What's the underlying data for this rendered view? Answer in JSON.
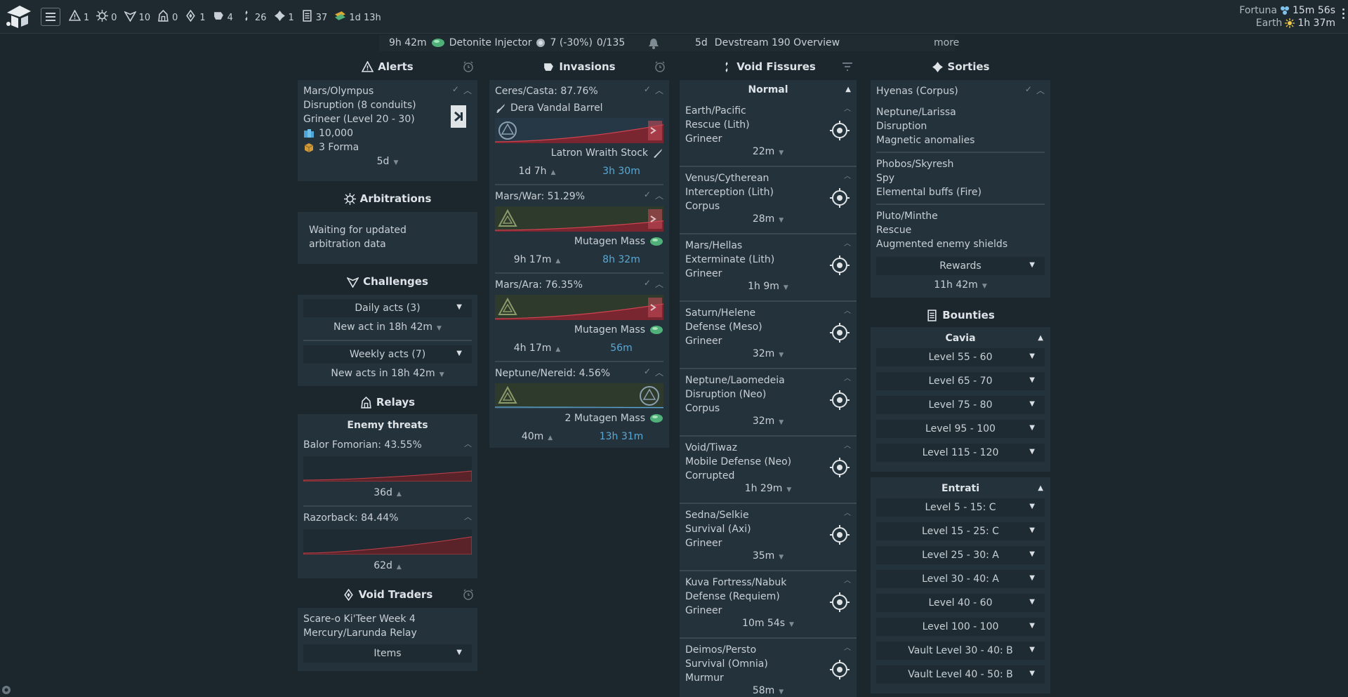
{
  "topbar": {
    "stats": [
      {
        "icon": "alert-icon",
        "value": "1"
      },
      {
        "icon": "arbitration-icon",
        "value": "0"
      },
      {
        "icon": "challenges-icon",
        "value": "10"
      },
      {
        "icon": "relays-icon",
        "value": "0"
      },
      {
        "icon": "void-trader-icon",
        "value": "1"
      },
      {
        "icon": "invasions-icon",
        "value": "4"
      },
      {
        "icon": "fissures-icon",
        "value": "26"
      },
      {
        "icon": "sorties-icon",
        "value": "1"
      },
      {
        "icon": "bounties-icon",
        "value": "37"
      },
      {
        "icon": "event-icon",
        "value": "1d 13h"
      }
    ],
    "cycles": [
      {
        "name": "Fortuna",
        "icon": "warm-cycle-icon",
        "time": "15m 56s"
      },
      {
        "name": "Earth",
        "icon": "day-cycle-icon",
        "time": "1h 37m"
      }
    ]
  },
  "news": {
    "deal_time": "9h 42m",
    "deal_item": "Detonite Injector",
    "deal_price": "7 (-30%)",
    "deal_stock": "0/135",
    "news_age": "5d",
    "news_title": "Devstream 190 Overview",
    "more": "more"
  },
  "alerts": {
    "title": "Alerts",
    "items": [
      {
        "node": "Mars/Olympus",
        "mission": "Disruption (8 conduits)",
        "enemy": "Grineer (Level 20 - 30)",
        "credits": "10,000",
        "reward": "3 Forma",
        "time": "5d"
      }
    ]
  },
  "arbitrations": {
    "title": "Arbitrations",
    "text1": "Waiting for updated",
    "text2": "arbitration data"
  },
  "challenges": {
    "title": "Challenges",
    "daily": "Daily acts (3)",
    "daily_next": "New act in 18h 42m",
    "weekly": "Weekly acts (7)",
    "weekly_next": "New acts in 18h 42m"
  },
  "relays": {
    "title": "Relays",
    "subtitle": "Enemy threats",
    "items": [
      {
        "name": "Balor Fomorian: 43.55%",
        "progress": 0.4355,
        "time": "36d"
      },
      {
        "name": "Razorback: 84.44%",
        "progress": 0.8444,
        "time": "62d"
      }
    ]
  },
  "void_traders": {
    "title": "Void Traders",
    "name": "Scare-o Ki'Teer Week 4",
    "location": "Mercury/Larunda Relay",
    "items_label": "Items"
  },
  "invasions": {
    "title": "Invasions",
    "items": [
      {
        "node": "Ceres/Casta: 87.76%",
        "progress": 0.8776,
        "attacker_reward": "Dera Vandal Barrel",
        "defender_reward": "Latron Wraith Stock",
        "eta": "1d 7h",
        "time": "3h 30m"
      },
      {
        "node": "Mars/War: 51.29%",
        "progress": 0.5129,
        "attacker_reward": "",
        "defender_reward": "Mutagen Mass",
        "eta": "9h 17m",
        "time": "8h 32m"
      },
      {
        "node": "Mars/Ara: 76.35%",
        "progress": 0.7635,
        "attacker_reward": "",
        "defender_reward": "Mutagen Mass",
        "eta": "4h 17m",
        "time": "56m"
      },
      {
        "node": "Neptune/Nereid: 4.56%",
        "progress": 0.0456,
        "attacker_reward": "",
        "defender_reward": "2 Mutagen Mass",
        "eta": "40m",
        "time": "13h 31m"
      }
    ]
  },
  "fissures": {
    "title": "Void Fissures",
    "group": "Normal",
    "items": [
      {
        "node": "Earth/Pacific",
        "mission": "Rescue (Lith)",
        "enemy": "Grineer",
        "time": "22m",
        "icon": "rescue-icon"
      },
      {
        "node": "Venus/Cytherean",
        "mission": "Interception (Lith)",
        "enemy": "Corpus",
        "time": "28m",
        "icon": "interception-icon"
      },
      {
        "node": "Mars/Hellas",
        "mission": "Exterminate (Lith)",
        "enemy": "Grineer",
        "time": "1h 9m",
        "icon": "exterminate-icon"
      },
      {
        "node": "Saturn/Helene",
        "mission": "Defense (Meso)",
        "enemy": "Grineer",
        "time": "32m",
        "icon": "defense-icon"
      },
      {
        "node": "Neptune/Laomedeia",
        "mission": "Disruption (Neo)",
        "enemy": "Corpus",
        "time": "32m",
        "icon": "disruption-icon"
      },
      {
        "node": "Void/Tiwaz",
        "mission": "Mobile Defense (Neo)",
        "enemy": "Corrupted",
        "time": "1h 29m",
        "icon": "mobile-defense-icon"
      },
      {
        "node": "Sedna/Selkie",
        "mission": "Survival (Axi)",
        "enemy": "Grineer",
        "time": "35m",
        "icon": "survival-icon"
      },
      {
        "node": "Kuva Fortress/Nabuk",
        "mission": "Defense (Requiem)",
        "enemy": "Grineer",
        "time": "10m 54s",
        "icon": "defense-icon"
      },
      {
        "node": "Deimos/Persto",
        "mission": "Survival (Omnia)",
        "enemy": "Murmur",
        "time": "58m",
        "icon": "omnia-icon"
      }
    ]
  },
  "sorties": {
    "title": "Sorties",
    "boss": "Hyenas (Corpus)",
    "missions": [
      {
        "node": "Neptune/Larissa",
        "type": "Disruption",
        "modifier": "Magnetic anomalies"
      },
      {
        "node": "Phobos/Skyresh",
        "type": "Spy",
        "modifier": "Elemental buffs (Fire)"
      },
      {
        "node": "Pluto/Minthe",
        "type": "Rescue",
        "modifier": "Augmented enemy shields"
      }
    ],
    "rewards": "Rewards",
    "time": "11h 42m"
  },
  "bounties": {
    "title": "Bounties",
    "groups": [
      {
        "name": "Cavia",
        "levels": [
          "Level 55 - 60",
          "Level 65 - 70",
          "Level 75 - 80",
          "Level 95 - 100",
          "Level 115 - 120"
        ]
      },
      {
        "name": "Entrati",
        "levels": [
          "Level 5 - 15: C",
          "Level 15 - 25: C",
          "Level 25 - 30: A",
          "Level 30 - 40: A",
          "Level 40 - 60",
          "Level 100 - 100",
          "Vault Level 30 - 40: B",
          "Vault Level 40 - 50: B"
        ]
      }
    ]
  },
  "colors": {
    "background": "#1c262d",
    "card": "#24323b",
    "timer_blue": "#5aa9d6",
    "invasion_red": "#b8323a",
    "relay_red": "#a8323a"
  }
}
